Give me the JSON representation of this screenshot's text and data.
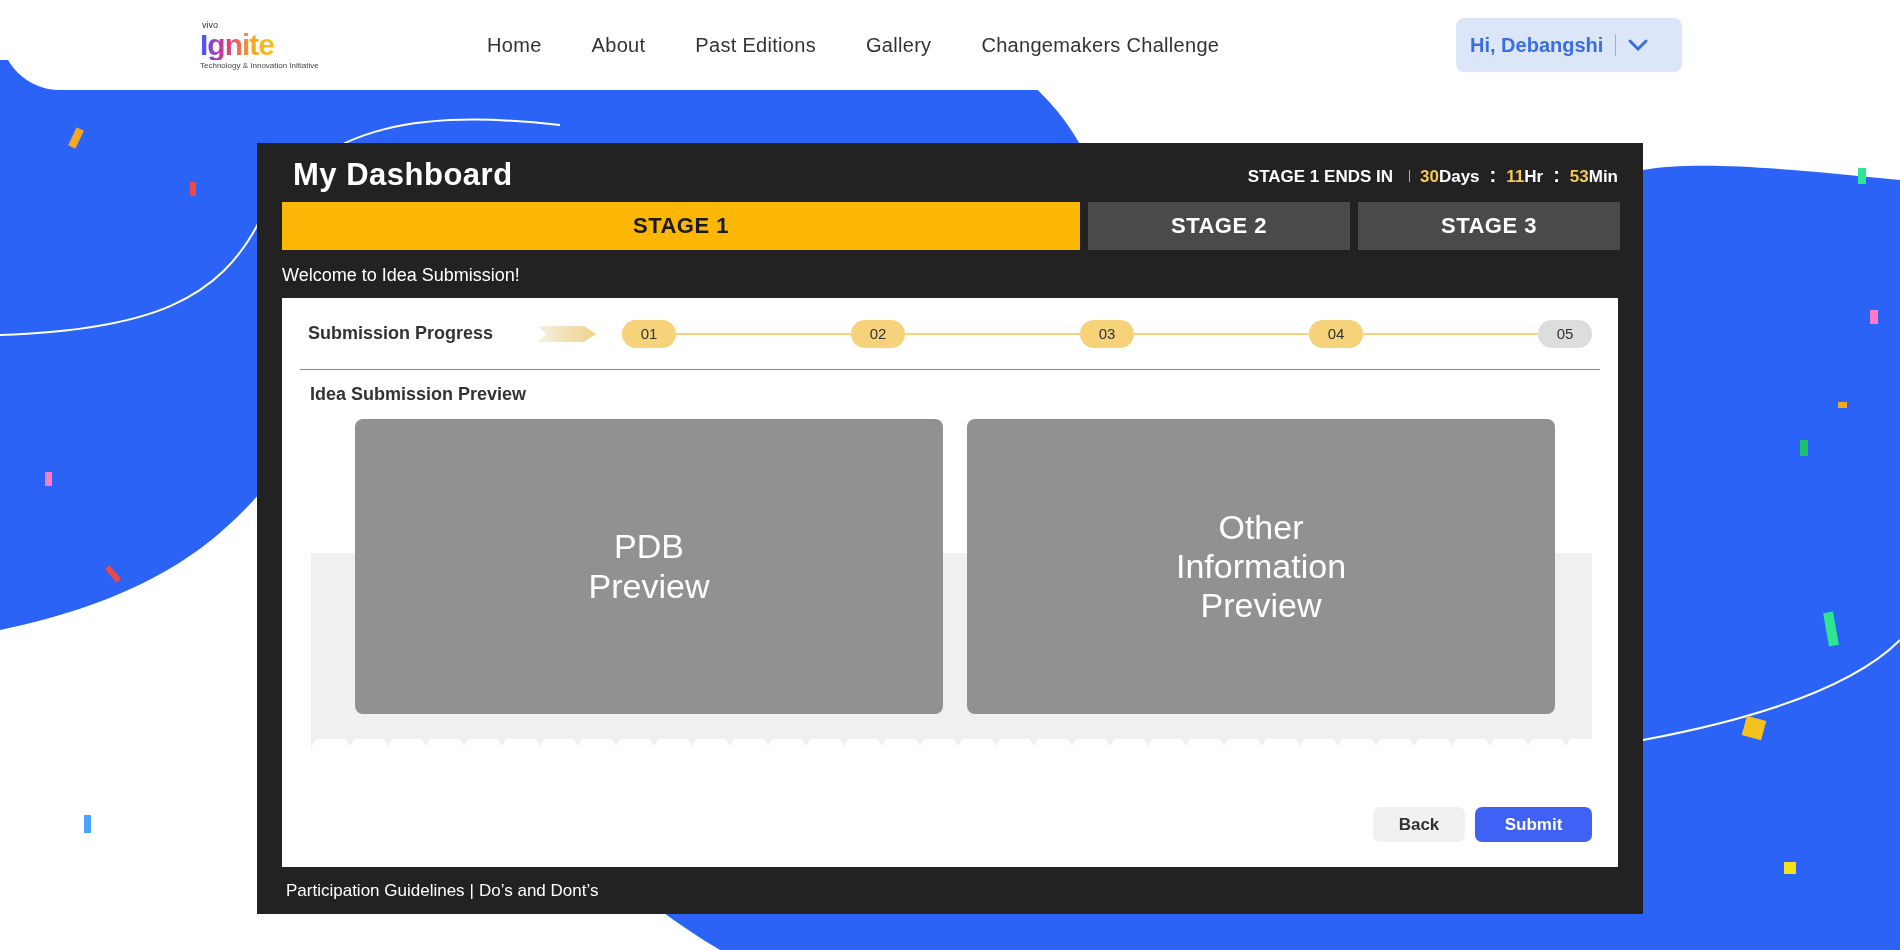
{
  "logo": {
    "brand": "vivo",
    "name": "Ignite",
    "tagline": "Technology & Innovation Initiative"
  },
  "nav": [
    "Home",
    "About",
    "Past Editions",
    "Gallery",
    "Changemakers Challenge"
  ],
  "user_menu": {
    "label": "Hi, Debangshi"
  },
  "dashboard": {
    "title": "My Dashboard",
    "timer": {
      "label": "STAGE 1 ENDS IN",
      "separator": ":",
      "parts": [
        {
          "value": "30",
          "unit": "Days"
        },
        {
          "value": "11",
          "unit": "Hr"
        },
        {
          "value": "53",
          "unit": "Min"
        }
      ]
    },
    "stages": [
      {
        "label": "STAGE 1",
        "selected": true
      },
      {
        "label": "STAGE 2",
        "selected": false
      },
      {
        "label": "STAGE 3",
        "selected": false
      }
    ],
    "welcome": "Welcome to Idea Submission!",
    "progress": {
      "label": "Submission Progress",
      "steps": [
        {
          "label": "01",
          "done": true
        },
        {
          "label": "02",
          "done": true
        },
        {
          "label": "03",
          "done": true
        },
        {
          "label": "04",
          "done": true
        },
        {
          "label": "05",
          "done": false
        }
      ]
    },
    "preview_heading": "Idea Submission Preview",
    "previews": [
      "PDB Preview",
      "Other Information Preview"
    ],
    "buttons": [
      {
        "label": "Back",
        "kind": "secondary"
      },
      {
        "label": "Submit",
        "kind": "primary"
      }
    ],
    "footer": {
      "links": [
        "Participation Guidelines",
        "Do’s and Dont’s"
      ],
      "separator": "|"
    }
  }
}
